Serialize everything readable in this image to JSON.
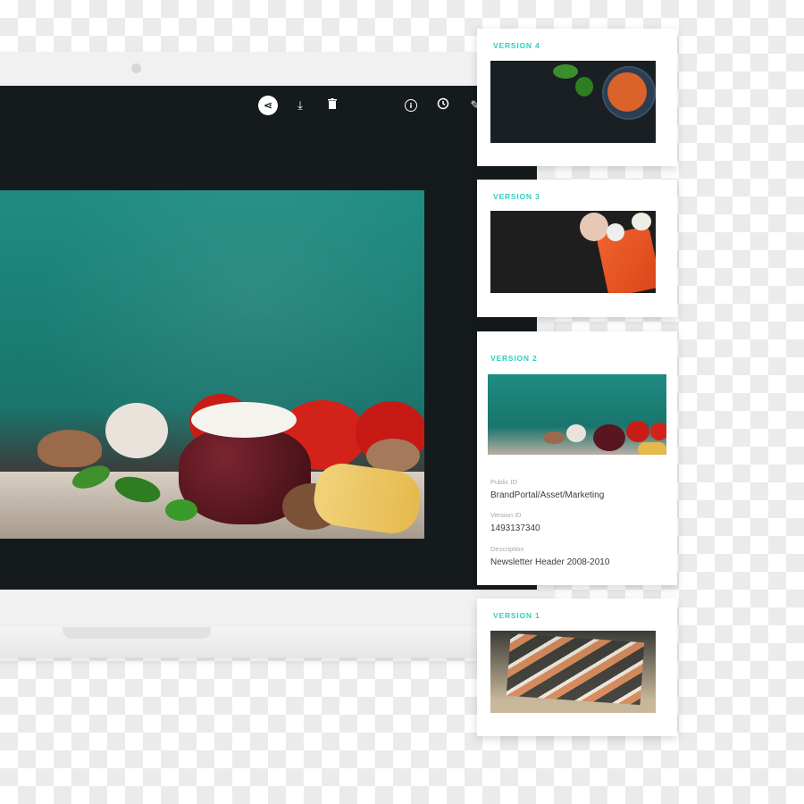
{
  "toolbar": {
    "share_icon": "share-icon",
    "download_icon": "download-icon",
    "delete_icon": "trash-icon",
    "info_icon": "info-icon",
    "history_icon": "clock-icon",
    "edit_icon": "pencil-icon",
    "share_glyph": "⋖",
    "download_glyph": "⤓",
    "delete_glyph": "🗑",
    "info_glyph": "i",
    "history_glyph": "◔",
    "edit_glyph": "✎"
  },
  "versions": [
    {
      "label": "VERSION 4"
    },
    {
      "label": "VERSION 3"
    },
    {
      "label": "VERSION 2",
      "fields": [
        {
          "label": "Public ID",
          "value": "BrandPortal/Asset/Marketing"
        },
        {
          "label": "Version ID",
          "value": "1493137340"
        },
        {
          "label": "Description",
          "value": "Newsletter Header 2008-2010"
        }
      ]
    },
    {
      "label": "VERSION 1"
    }
  ],
  "colors": {
    "accent": "#2ecfbf",
    "screen": "#151a1d",
    "teal_background": "#1f8c82"
  }
}
